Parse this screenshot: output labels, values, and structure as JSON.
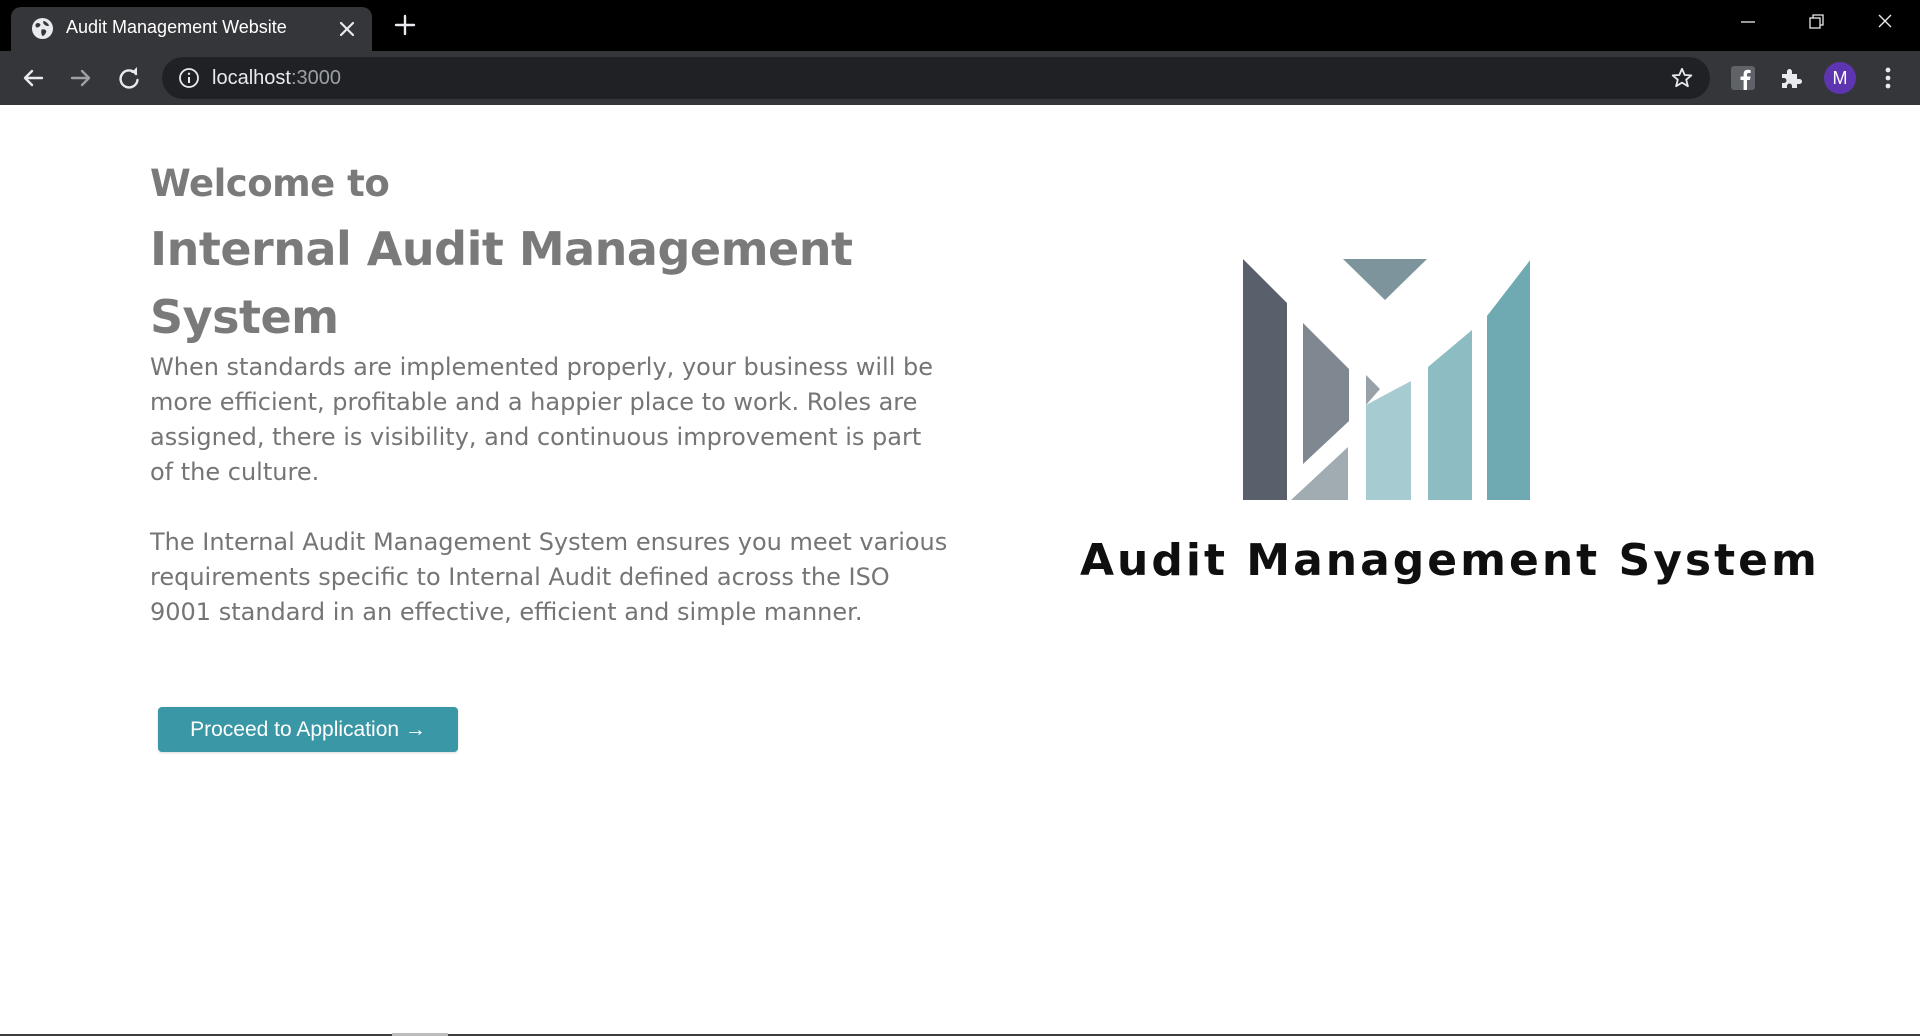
{
  "browser": {
    "tab_title": "Audit Management Website",
    "url_host": "localhost",
    "url_port": ":3000",
    "profile_initial": "M"
  },
  "page": {
    "welcome": "Welcome to",
    "title": "Internal Audit Management System",
    "paragraph_1": "When standards are implemented properly, your business will be more efficient, profitable and a happier place to work. Roles are assigned, there is visibility, and continuous improvement is part of the culture.",
    "paragraph_2": "The Internal Audit Management System ensures you meet various requirements specific to Internal Audit defined across the ISO 9001 standard in an effective, efficient and simple manner.",
    "proceed_button": "Proceed to Application →",
    "logo_text": "Audit Management System"
  },
  "colors": {
    "accent": "#3a97a6",
    "heading_gray": "#7a7a7a",
    "logo_dark": "#59606b",
    "logo_teal": "#6faab2"
  },
  "icons": {
    "tab_favicon": "globe-icon",
    "tab_close": "close-icon",
    "new_tab": "plus-icon",
    "back": "arrow-left-icon",
    "forward": "arrow-right-icon",
    "reload": "reload-icon",
    "site_info": "info-icon",
    "bookmark": "star-icon",
    "extension_1": "facebook-icon",
    "extensions": "puzzle-icon",
    "menu": "kebab-menu-icon"
  }
}
